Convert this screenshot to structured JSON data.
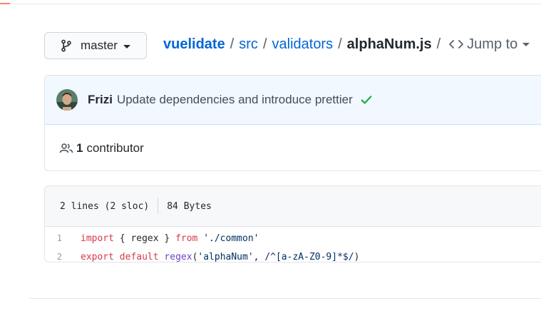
{
  "branch": {
    "name": "master",
    "icon": "git-branch-icon"
  },
  "breadcrumb": {
    "repo": "vuelidate",
    "dir1": "src",
    "dir2": "validators",
    "file": "alphaNum.js",
    "sep": "/",
    "jump_label": "Jump to"
  },
  "commit": {
    "author": "Frizi",
    "message": "Update dependencies and introduce prettier",
    "status": "success"
  },
  "contributors": {
    "count": "1",
    "label": "contributor"
  },
  "file_info": {
    "lines": "2 lines (2 sloc)",
    "size": "84 Bytes"
  },
  "code_lines": [
    {
      "num": "1",
      "tokens": [
        {
          "t": "import",
          "c": "kw"
        },
        {
          "t": " { regex } ",
          "c": "plain"
        },
        {
          "t": "from",
          "c": "kw"
        },
        {
          "t": " ",
          "c": "plain"
        },
        {
          "t": "'./common'",
          "c": "str"
        }
      ]
    },
    {
      "num": "2",
      "tokens": [
        {
          "t": "export",
          "c": "kw"
        },
        {
          "t": " ",
          "c": "plain"
        },
        {
          "t": "default",
          "c": "kw"
        },
        {
          "t": " ",
          "c": "plain"
        },
        {
          "t": "regex",
          "c": "fn"
        },
        {
          "t": "(",
          "c": "plain"
        },
        {
          "t": "'alphaNum'",
          "c": "str"
        },
        {
          "t": ", ",
          "c": "plain"
        },
        {
          "t": "/^[a-zA-Z0-9]*$/",
          "c": "str"
        },
        {
          "t": ")",
          "c": "plain"
        }
      ]
    }
  ],
  "colors": {
    "link": "#0366d6",
    "keyword": "#d73a49",
    "string": "#032f62",
    "function": "#6f42c1",
    "success": "#28a745",
    "commit_bg": "#f1f8ff"
  }
}
